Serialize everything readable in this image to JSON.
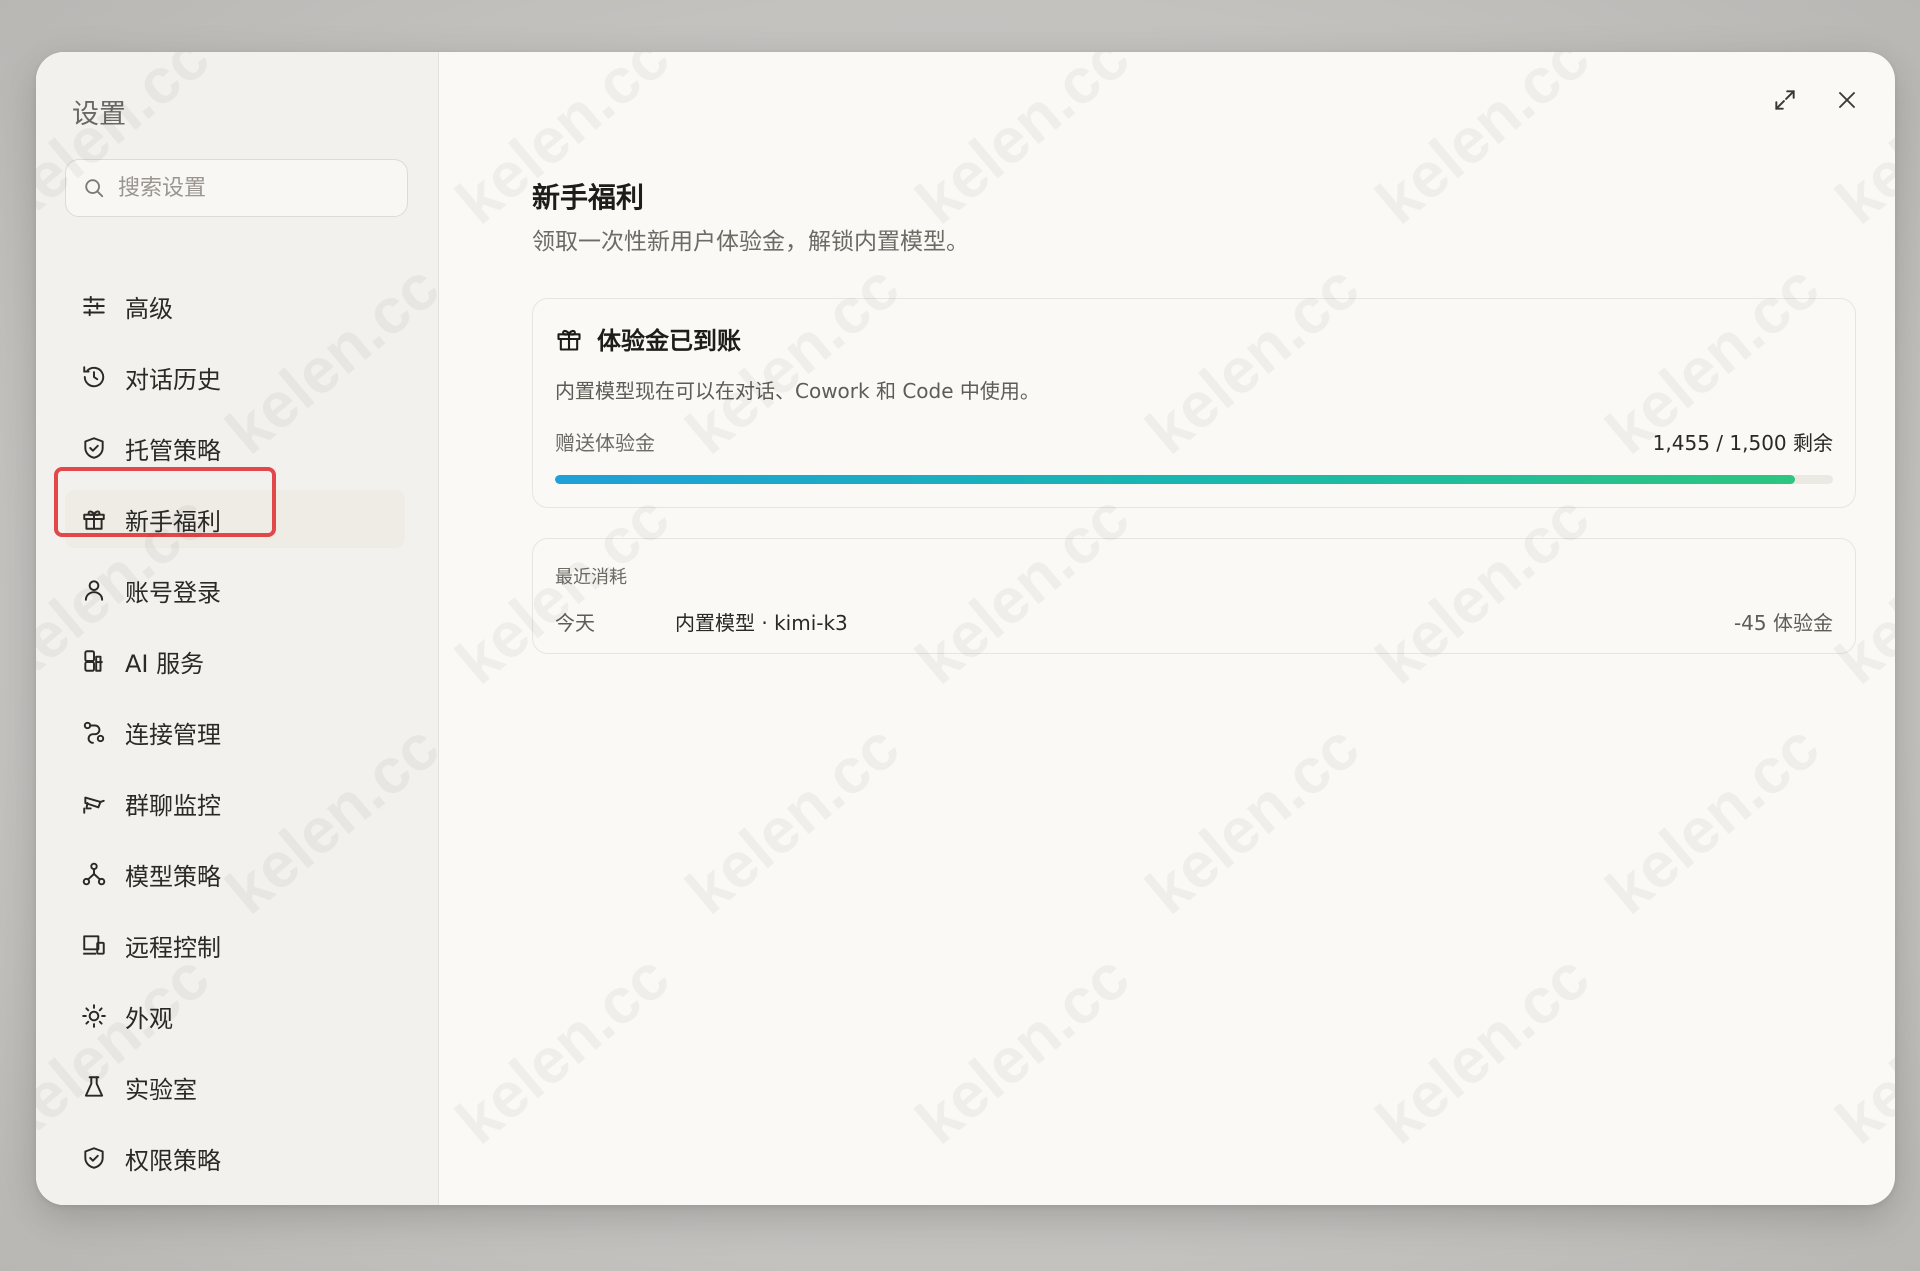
{
  "sidebar": {
    "title": "设置",
    "search_placeholder": "搜索设置",
    "items": [
      {
        "label": "高级",
        "icon": "sliders-icon"
      },
      {
        "label": "对话历史",
        "icon": "history-icon"
      },
      {
        "label": "托管策略",
        "icon": "shield-check-icon"
      },
      {
        "label": "新手福利",
        "icon": "gift-icon",
        "active": true
      },
      {
        "label": "账号登录",
        "icon": "user-icon"
      },
      {
        "label": "AI 服务",
        "icon": "ai-service-icon"
      },
      {
        "label": "连接管理",
        "icon": "connection-icon"
      },
      {
        "label": "群聊监控",
        "icon": "camera-icon"
      },
      {
        "label": "模型策略",
        "icon": "network-icon"
      },
      {
        "label": "远程控制",
        "icon": "remote-desktop-icon"
      },
      {
        "label": "外观",
        "icon": "sun-icon"
      },
      {
        "label": "实验室",
        "icon": "flask-icon"
      },
      {
        "label": "权限策略",
        "icon": "shield-check-icon"
      }
    ]
  },
  "header": {
    "title": "新手福利",
    "subtitle": "领取一次性新用户体验金，解锁内置模型。"
  },
  "bonus_card": {
    "title": "体验金已到账",
    "description": "内置模型现在可以在对话、Cowork 和 Code 中使用。",
    "gift_label": "赠送体验金",
    "remaining_text": "1,455 / 1,500 剩余",
    "remaining": 1455,
    "total": 1500
  },
  "usage_card": {
    "label": "最近消耗",
    "rows": [
      {
        "date": "今天",
        "item": "内置模型 · kimi-k3",
        "amount": "-45 体验金"
      }
    ]
  },
  "watermark": "kelen.cc",
  "colors": {
    "highlight": "#e2474a",
    "progress_start": "#1fa0d8",
    "progress_end": "#2cc67f"
  }
}
